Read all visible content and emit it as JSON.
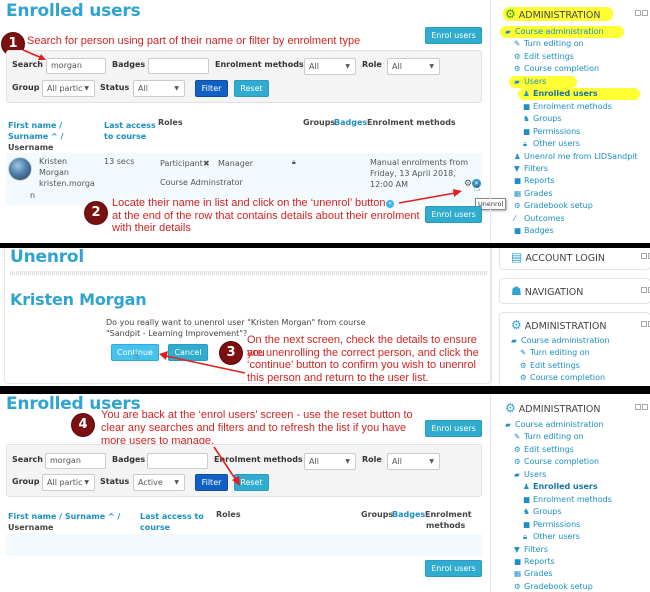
{
  "colors": {
    "title": "#2fa4d1",
    "link": "#1a8fc4",
    "annotation": "#d32424",
    "step_badge": "#7a1010",
    "highlight": "#ffff33",
    "button_cyan": "#30acd0",
    "button_filter": "#1160c4"
  },
  "panel1": {
    "page_title": "Enrolled users",
    "enrol_button": "Enrol users",
    "step": "1",
    "annotation": "Search for person using part of their name or filter by enrolment type",
    "filters": {
      "search_label": "Search",
      "search_value": "morgan",
      "badges_label": "Badges",
      "badges_value": "",
      "enrolment_methods_label": "Enrolment methods",
      "enrolment_methods_value": "All",
      "role_label": "Role",
      "role_value": "All",
      "group_label": "Group",
      "group_value": "All partic",
      "status_label": "Status",
      "status_value": "All",
      "filter_button": "Filter",
      "reset_button": "Reset"
    },
    "table": {
      "headers": {
        "first_name": "First name /",
        "surname": "Surname ^ /",
        "username": "Username",
        "last_access_1": "Last access",
        "last_access_2": "to course",
        "roles": "Roles",
        "groups": "Groups",
        "badges": "Badges",
        "enrolment_methods": "Enrolment methods"
      },
      "rows": [
        {
          "first_name": "Kristen",
          "surname": "Morgan",
          "username_1": "kristen.morga",
          "username_2": "n",
          "last_access": "13 secs",
          "role_1": "Participant",
          "role_remove": "✖",
          "role_2": "Manager",
          "role_3": "Course Adminstrator",
          "enrolment_1": "Manual enrolments from",
          "enrolment_2": "Friday, 13 April 2018,",
          "enrolment_3": "12:00 AM"
        }
      ]
    },
    "tooltip": "Unenrol",
    "step2": "2",
    "annotation2_line1": "Locate their name in list and click on the ‘unenrol’ button",
    "annotation2_line2": "at the end of the row that contains details about their enrolment",
    "annotation2_line3": "with their details",
    "enrol_button_bottom": "Enrol users"
  },
  "sidebar1": {
    "header": "ADMINISTRATION",
    "items": [
      {
        "label": "Course administration",
        "icon": "folder-open-icon"
      },
      {
        "label": "Turn editing on",
        "icon": "pencil-icon"
      },
      {
        "label": "Edit settings",
        "icon": "cogs-icon"
      },
      {
        "label": "Course completion",
        "icon": "cogs-icon"
      },
      {
        "label": "Users",
        "icon": "folder-open-icon"
      },
      {
        "label": "Enrolled users",
        "icon": "user-plus-icon"
      },
      {
        "label": "Enrolment methods",
        "icon": "folder-icon"
      },
      {
        "label": "Groups",
        "icon": "users-icon"
      },
      {
        "label": "Permissions",
        "icon": "folder-icon"
      },
      {
        "label": "Other users",
        "icon": "lock-icon"
      },
      {
        "label": "Unenrol me from LIDSandpit",
        "icon": "user-icon"
      },
      {
        "label": "Filters",
        "icon": "filter-icon"
      },
      {
        "label": "Reports",
        "icon": "folder-icon"
      },
      {
        "label": "Grades",
        "icon": "table-icon"
      },
      {
        "label": "Gradebook setup",
        "icon": "cogs-icon"
      },
      {
        "label": "Outcomes",
        "icon": "magic-icon"
      },
      {
        "label": "Badges",
        "icon": "folder-icon"
      }
    ]
  },
  "panel2": {
    "page_title": "Unenrol",
    "user_name": "Kristen Morgan",
    "question_line1": "Do you really want to unenrol user \"Kristen Morgan\" from course",
    "question_line2": "\"Sandpit - Learning Improvement\"?",
    "continue_button": "Continue",
    "cancel_button": "Cancel",
    "step": "3",
    "annotation_line1": "On the next screen, check the details to ensure you",
    "annotation_line2": "are unenrolling the correct person, and click the",
    "annotation_line3": "‘continue’ button to confirm you wish to unenrol",
    "annotation_line4": "this person and return to the user list."
  },
  "sidebar2": {
    "account_login": "ACCOUNT LOGIN",
    "navigation": "NAVIGATION",
    "administration": "ADMINISTRATION",
    "items": [
      {
        "label": "Course administration"
      },
      {
        "label": "Turn editing on"
      },
      {
        "label": "Edit settings"
      },
      {
        "label": "Course completion"
      }
    ]
  },
  "panel3": {
    "page_title": "Enrolled users",
    "enrol_button": "Enrol users",
    "step": "4",
    "annotation_line1": "You are back at the ‘enrol users’ screen - use the reset button to",
    "annotation_line2": "clear any searches and filters and to refresh the list if you have",
    "annotation_line3": "more users to manage.",
    "filters": {
      "search_label": "Search",
      "search_value": "morgan",
      "badges_label": "Badges",
      "badges_value": "",
      "enrolment_methods_label": "Enrolment methods",
      "enrolment_methods_value": "All",
      "role_label": "Role",
      "role_value": "All",
      "group_label": "Group",
      "group_value": "All partic",
      "status_label": "Status",
      "status_value": "Active",
      "filter_button": "Filter",
      "reset_button": "Reset"
    },
    "table": {
      "headers": {
        "first_name": "First name /",
        "surname": "Surname ^ /",
        "username": "Username",
        "last_access_1": "Last access to",
        "last_access_2": "course",
        "roles": "Roles",
        "groups": "Groups",
        "badges": "Badges",
        "enrolment_methods_1": "Enrolment",
        "enrolment_methods_2": "methods"
      }
    },
    "enrol_button_bottom": "Enrol users"
  },
  "sidebar3": {
    "header": "ADMINISTRATION",
    "items": [
      {
        "label": "Course administration"
      },
      {
        "label": "Turn editing on"
      },
      {
        "label": "Edit settings"
      },
      {
        "label": "Course completion"
      },
      {
        "label": "Users"
      },
      {
        "label": "Enrolled users"
      },
      {
        "label": "Enrolment methods"
      },
      {
        "label": "Groups"
      },
      {
        "label": "Permissions"
      },
      {
        "label": "Other users"
      },
      {
        "label": "Filters"
      },
      {
        "label": "Reports"
      },
      {
        "label": "Grades"
      },
      {
        "label": "Gradebook setup"
      }
    ]
  }
}
